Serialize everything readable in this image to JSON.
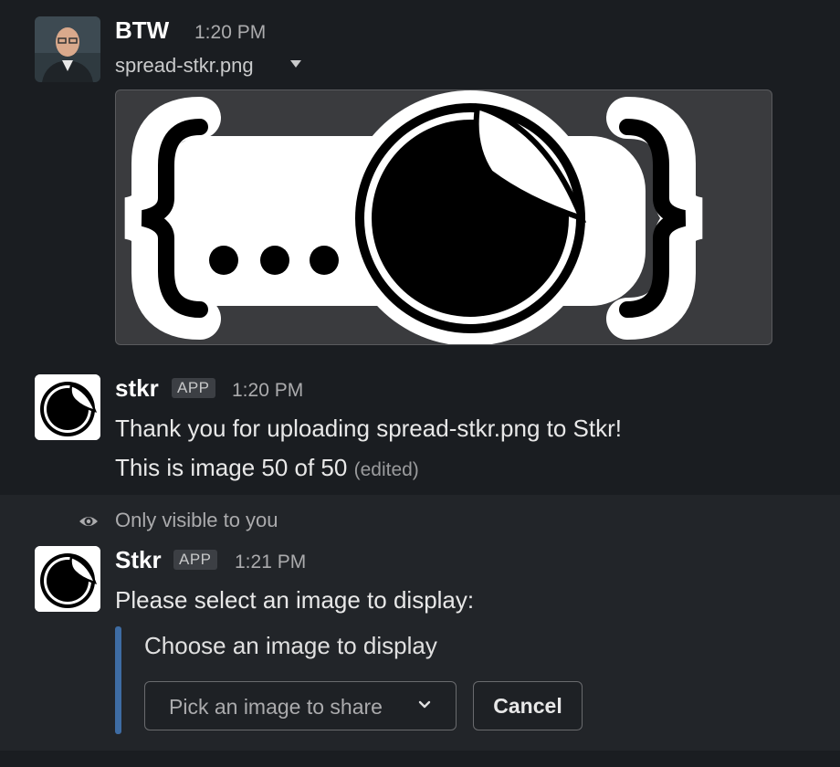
{
  "messages": [
    {
      "author": "BTW",
      "time": "1:20 PM",
      "file_name": "spread-stkr.png",
      "avatar_icon": "person-photo-avatar"
    },
    {
      "author": "stkr",
      "badge": "APP",
      "time": "1:20 PM",
      "line1": "Thank you for uploading spread-stkr.png to Stkr!",
      "line2": "This is image 50 of 50",
      "edited": "(edited)",
      "avatar_icon": "sticker-avatar"
    }
  ],
  "ephemeral": {
    "notice": "Only visible to you",
    "author": "Stkr",
    "badge": "APP",
    "time": "1:21 PM",
    "text": "Please select an image to display:",
    "block_title": "Choose an image to display",
    "select_placeholder": "Pick an image to share",
    "cancel_label": "Cancel"
  },
  "colors": {
    "background": "#1a1d21",
    "ephemeral_background": "#222529",
    "accent_bar": "#3e6ca3"
  }
}
